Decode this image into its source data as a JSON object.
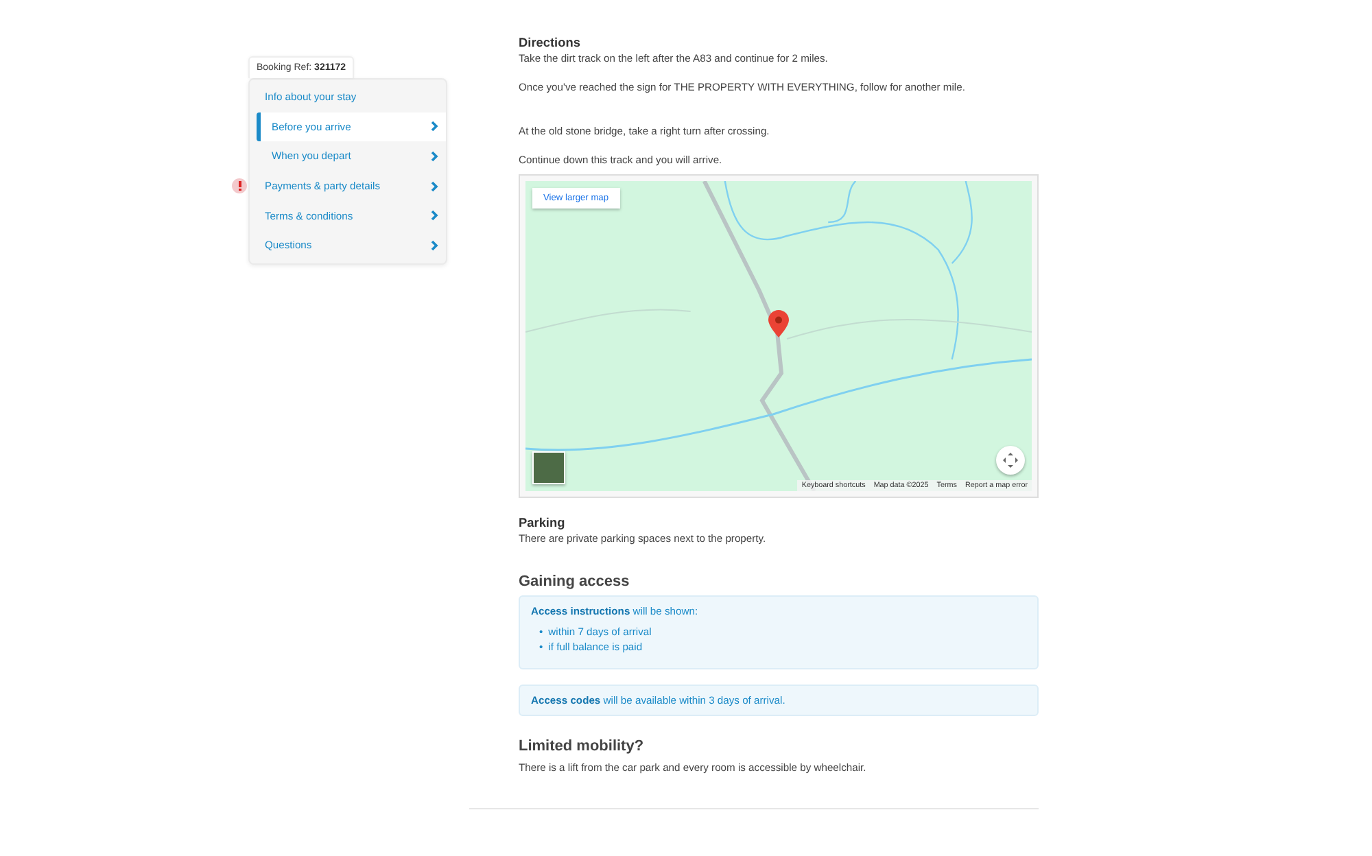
{
  "booking_ref": {
    "label": "Booking Ref:",
    "value": "321172"
  },
  "nav": [
    {
      "label": "Info about your stay",
      "kind": "top",
      "selected": false,
      "chevron": false,
      "alert": false
    },
    {
      "label": "Before you arrive",
      "kind": "sub",
      "selected": true,
      "chevron": true,
      "alert": false
    },
    {
      "label": "When you depart",
      "kind": "sub",
      "selected": false,
      "chevron": true,
      "alert": false
    },
    {
      "label": "Payments & party details",
      "kind": "top",
      "selected": false,
      "chevron": true,
      "alert": true
    },
    {
      "label": "Terms & conditions",
      "kind": "top",
      "selected": false,
      "chevron": true,
      "alert": false
    },
    {
      "label": "Questions",
      "kind": "top",
      "selected": false,
      "chevron": true,
      "alert": false
    }
  ],
  "directions": {
    "heading": "Directions",
    "paragraphs": [
      "Take the dirt track on the left after the A83 and continue for 2 miles.",
      "Once you've reached the sign for THE PROPERTY WITH EVERYTHING, follow for another mile.",
      "At the old stone bridge, take a right turn after crossing.",
      "Continue down this track and you will arrive."
    ]
  },
  "map": {
    "larger_map_button": "View larger map",
    "footer": [
      "Keyboard shortcuts",
      "Map data ©2025",
      "Terms",
      "Report a map error"
    ]
  },
  "parking": {
    "heading": "Parking",
    "text": "There are private parking spaces next to the property."
  },
  "gaining_access": {
    "heading": "Gaining access",
    "instructions": "**Access instructions** will be shown:",
    "bullet": "•",
    "conditions": [
      "within 7 days of arrival",
      "if full balance is paid"
    ],
    "codes": "**Access codes** will be available within 3 days of arrival."
  },
  "limited_mobility": {
    "heading": "Limited mobility?",
    "text": "There is a lift from the car park and every room is accessible by wheelchair."
  }
}
